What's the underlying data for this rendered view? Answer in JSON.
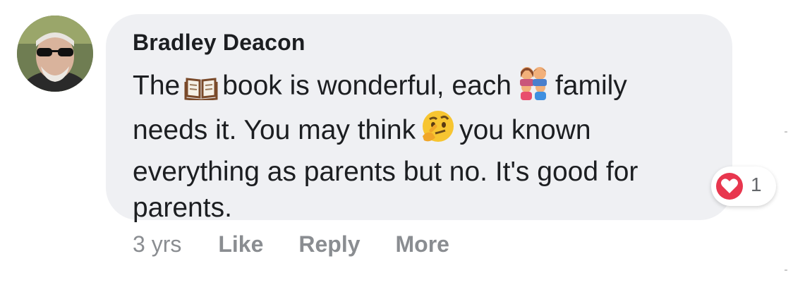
{
  "comment": {
    "author": "Bradley Deacon",
    "text_parts": [
      "The",
      "book is wonderful, each",
      "family",
      "needs it. You may think",
      "you known",
      "everything as parents but no. It's good for",
      "parents."
    ],
    "emojis": [
      "open-book-icon",
      "family-icon",
      "thinking-face-icon"
    ]
  },
  "reaction": {
    "icon": "heart-reaction-icon",
    "count": "1",
    "color": "#e8364e"
  },
  "actions": {
    "time": "3 yrs",
    "like": "Like",
    "reply": "Reply",
    "more": "More"
  }
}
